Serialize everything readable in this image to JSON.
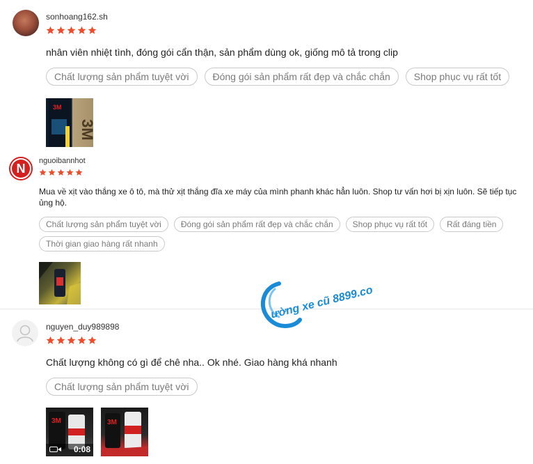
{
  "reviews": [
    {
      "username": "sonhoang162.sh",
      "rating": 5,
      "comment": "nhân viên nhiệt tình, đóng gói cẩn thận, sản phẩm dùng ok, giống mô tả trong clip",
      "tags": [
        "Chất lượng sản phẩm tuyệt vời",
        "Đóng gói sản phẩm rất đẹp và chắc chắn",
        "Shop phục vụ rất tốt"
      ]
    },
    {
      "username": "nguoibannhot",
      "avatar_letter": "N",
      "rating": 5,
      "comment": "Mua về xịt vào thắng xe ô tô, mà thử xịt thắng đĩa xe máy của mình phanh khác hẳn luôn. Shop tư vấn hơi bị xịn luôn. Sẽ tiếp tục ủng hộ.",
      "tags": [
        "Chất lượng sản phẩm tuyệt vời",
        "Đóng gói sản phẩm rất đẹp và chắc chắn",
        "Shop phục vụ rất tốt",
        "Rất đáng tiền",
        "Thời gian giao hàng rất nhanh"
      ]
    },
    {
      "username": "nguyen_duy989898",
      "rating": 5,
      "comment": "Chất lượng không có gì để chê nha.. Ok nhé. Giao hàng khá nhanh",
      "tags": [
        "Chất lượng sản phẩm tuyệt vời"
      ],
      "video_duration": "0:08"
    }
  ],
  "watermark": "ường xe cũ 8899.com",
  "colors": {
    "star": "#ee4d2d",
    "tag_border": "#c9c9c9",
    "accent_blue": "#1a8bd6"
  },
  "product_brand": "3M"
}
